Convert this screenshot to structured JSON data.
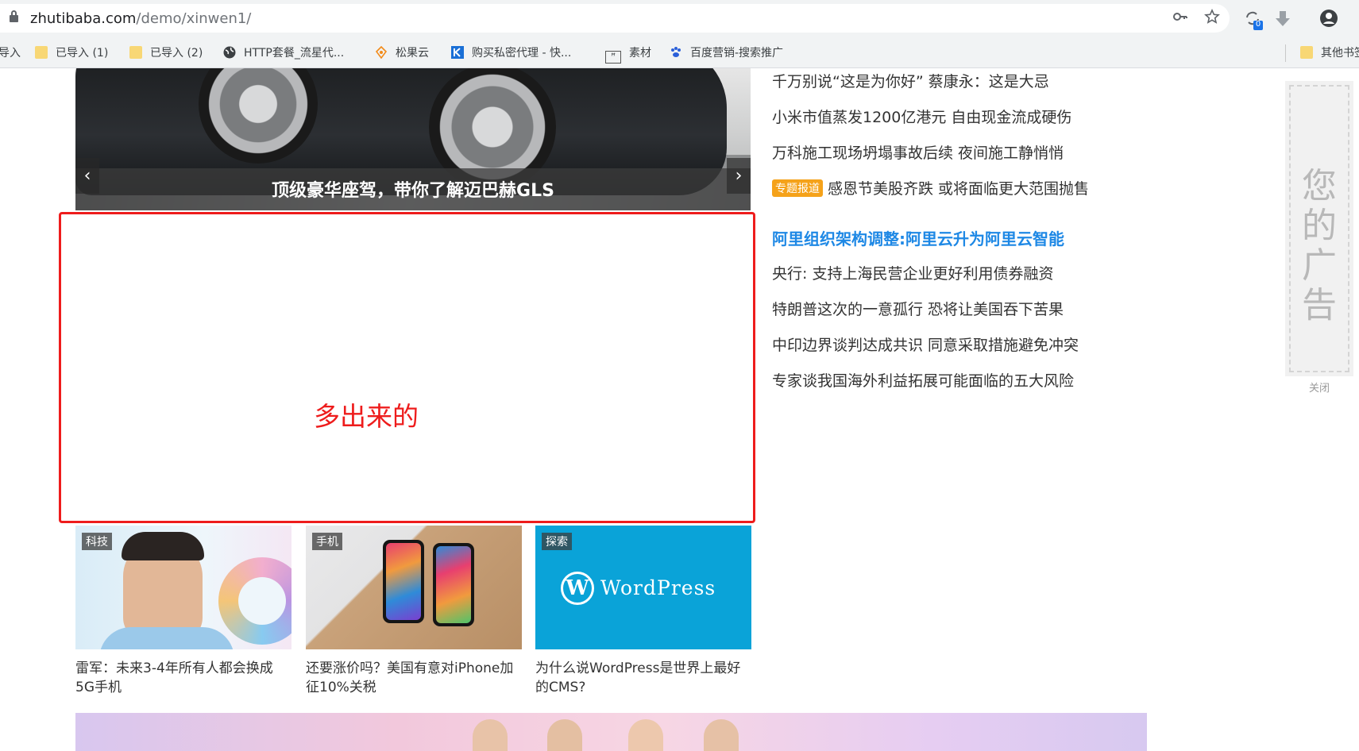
{
  "browser": {
    "url_domain": "zhutibaba.com",
    "url_path": "/demo/xinwen1/",
    "sync_badge": "0",
    "bookmarks": [
      {
        "label": "导入",
        "icon": "none"
      },
      {
        "label": "已导入 (1)",
        "icon": "folder-icon"
      },
      {
        "label": "已导入 (2)",
        "icon": "folder-icon"
      },
      {
        "label": "HTTP套餐_流星代...",
        "icon": "globe-icon"
      },
      {
        "label": "松果云",
        "icon": "pinecone-icon"
      },
      {
        "label": "购买私密代理 - 快...",
        "icon": "k-logo-icon"
      },
      {
        "label": "素材",
        "icon": "sucai-logo-icon"
      },
      {
        "label": "百度营销-搜索推广",
        "icon": "baidu-paw-icon"
      },
      {
        "label": "其他书签",
        "icon": "folder-icon"
      }
    ]
  },
  "slider": {
    "caption": "顶级豪华座驾，带你了解迈巴赫GLS",
    "prev": "‹",
    "next": "›"
  },
  "highlight": {
    "label": "多出来的",
    "color": "#ee1c1c"
  },
  "news_right": {
    "items_top": [
      "千万别说“这是为你好” 蔡康永：这是大忌",
      "小米市值蒸发1200亿港元 自由现金流成硬伤",
      "万科施工现场坍塌事故后续 夜间施工静悄悄"
    ],
    "special_tag": "专题报道",
    "special_item": "感恩节美股齐跌 或将面临更大范围抛售",
    "headline": "阿里组织架构调整:阿里云升为阿里云智能",
    "items_bottom": [
      "央行: 支持上海民营企业更好利用债券融资",
      "特朗普这次的一意孤行 恐将让美国吞下苦果",
      "中印边界谈判达成共识 同意采取措施避免冲突",
      "专家谈我国海外利益拓展可能面临的五大风险"
    ]
  },
  "ad": {
    "chars": [
      "您",
      "的",
      "广",
      "告"
    ],
    "close": "关闭"
  },
  "cards": [
    {
      "tag": "科技",
      "title": "雷军：未来3-4年所有人都会换成5G手机"
    },
    {
      "tag": "手机",
      "title": "还要涨价吗？美国有意对iPhone加征10%关税"
    },
    {
      "tag": "探索",
      "title": "为什么说WordPress是世界上最好的CMS?",
      "logo_text": "WordPress"
    }
  ],
  "colors": {
    "accent_blue": "#1e88e5",
    "tag_orange": "#f5a21a",
    "wordpress_blue": "#0aa3d8"
  }
}
